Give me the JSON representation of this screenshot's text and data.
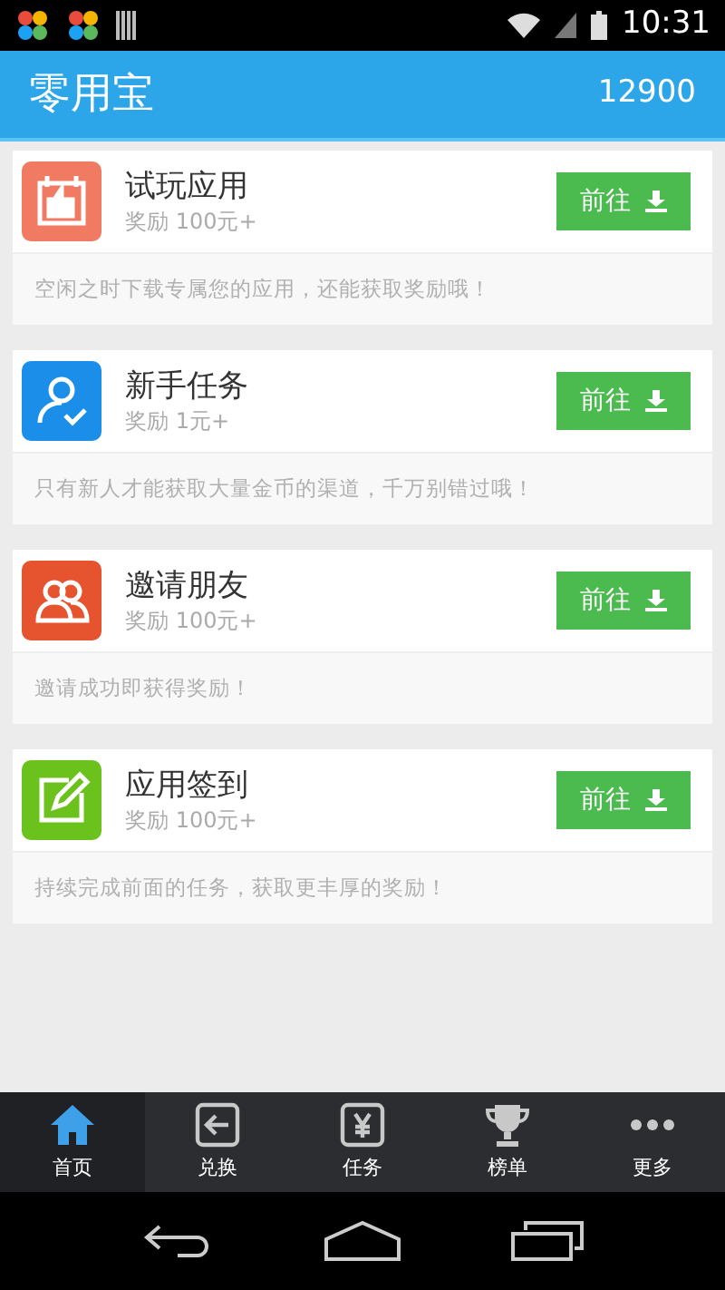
{
  "status_bar": {
    "time": "10:31"
  },
  "header": {
    "title": "零用宝",
    "balance": "12900"
  },
  "tasks": [
    {
      "kind": "trial",
      "color": "#f07a62",
      "title": "试玩应用",
      "reward": "奖励 100元+",
      "button": "前往",
      "description": "空闲之时下载专属您的应用，还能获取奖励哦！"
    },
    {
      "kind": "newbie",
      "color": "#1a8ee8",
      "title": "新手任务",
      "reward": "奖励 1元+",
      "button": "前往",
      "description": "只有新人才能获取大量金币的渠道，千万别错过哦！"
    },
    {
      "kind": "invite",
      "color": "#e5532f",
      "title": "邀请朋友",
      "reward": "奖励 100元+",
      "button": "前往",
      "description": "邀请成功即获得奖励！"
    },
    {
      "kind": "checkin",
      "color": "#6cc21c",
      "title": "应用签到",
      "reward": "奖励 100元+",
      "button": "前往",
      "description": "持续完成前面的任务，获取更丰厚的奖励！"
    }
  ],
  "tabs": [
    {
      "kind": "home",
      "label": "首页",
      "selected": true
    },
    {
      "kind": "exchange",
      "label": "兑换",
      "selected": false
    },
    {
      "kind": "task",
      "label": "任务",
      "selected": false
    },
    {
      "kind": "rank",
      "label": "榜单",
      "selected": false
    },
    {
      "kind": "more",
      "label": "更多",
      "selected": false
    }
  ]
}
